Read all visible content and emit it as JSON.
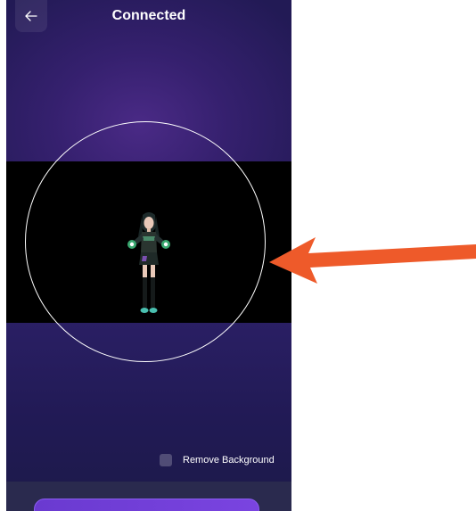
{
  "header": {
    "title": "Connected",
    "back_icon": "arrow-left-icon"
  },
  "options": {
    "remove_background_label": "Remove Background",
    "remove_background_checked": false
  },
  "colors": {
    "background_top": "#4a2a86",
    "background_bottom": "#211a55",
    "video_band": "#000000",
    "annotation_arrow": "#ee5a2a",
    "primary_button": "#6a3ad0"
  }
}
